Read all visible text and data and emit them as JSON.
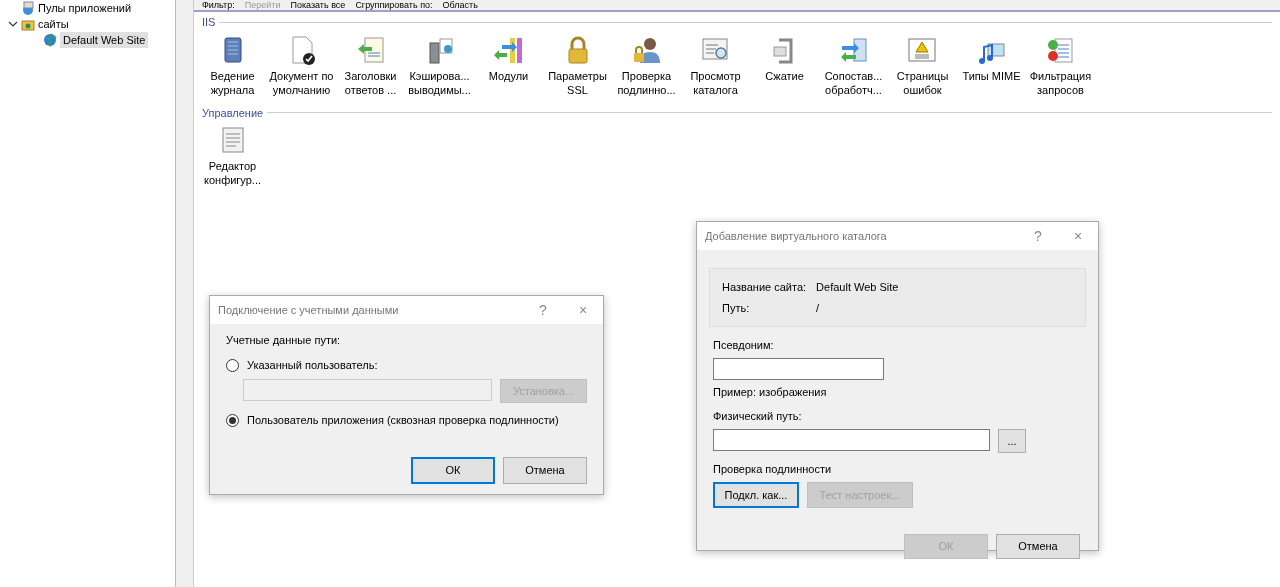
{
  "toolbar": {
    "items": [
      {
        "label": "Фильтр:",
        "kind": "label"
      },
      {
        "label": "Перейти",
        "kind": "button",
        "disabled": true
      },
      {
        "label": "Показать все",
        "kind": "button",
        "disabled": false
      },
      {
        "label": "Сгруппировать по:",
        "kind": "label"
      },
      {
        "label": "Область",
        "kind": "value"
      }
    ]
  },
  "tree": [
    {
      "label": "Пулы приложений",
      "selected": false
    },
    {
      "label": "сайты",
      "expanded": true,
      "selected": false,
      "children": [
        {
          "label": "Default Web Site",
          "selected": true
        }
      ]
    }
  ],
  "sections": [
    {
      "title": "IIS",
      "features": [
        {
          "label": "Ведение журнала"
        },
        {
          "label": "Документ по умолчанию"
        },
        {
          "label": "Заголовки ответов ..."
        },
        {
          "label": "Кэширова... выводимы..."
        },
        {
          "label": "Модули"
        },
        {
          "label": "Параметры SSL"
        },
        {
          "label": "Проверка подлинно..."
        },
        {
          "label": "Просмотр каталога"
        },
        {
          "label": "Сжатие"
        },
        {
          "label": "Сопостав... обработч..."
        },
        {
          "label": "Страницы ошибок"
        },
        {
          "label": "Типы MIME"
        },
        {
          "label": "Фильтрация запросов"
        }
      ]
    },
    {
      "title": "Управление",
      "features": [
        {
          "label": "Редактор конфигур..."
        }
      ]
    }
  ],
  "credentials_dialog": {
    "title": "Подключение с учетными данными",
    "help": "?",
    "close": "×",
    "group_label": "Учетные данные пути:",
    "options": [
      {
        "label": "Указанный пользователь:",
        "selected": false
      },
      {
        "label": "Пользователь приложения (сквозная проверка подлинности)",
        "selected": true
      }
    ],
    "user_field": {
      "disabled": true
    },
    "set_button": {
      "label": "Установка...",
      "disabled": true
    },
    "buttons": [
      {
        "label": "ОК",
        "disabled": false,
        "focused": true
      },
      {
        "label": "Отмена",
        "disabled": false,
        "focused": false
      }
    ]
  },
  "vdir_dialog": {
    "title": "Добавление виртуального каталога",
    "help": "?",
    "close": "×",
    "info": [
      {
        "label": "Название сайта:",
        "value": "Default Web Site"
      },
      {
        "label": "Путь:",
        "value": "/"
      }
    ],
    "alias_label": "Псевдоним:",
    "example": "Пример: изображения",
    "path_label": "Физический путь:",
    "browse": "...",
    "auth_label": "Проверка подлинности",
    "auth_buttons": [
      {
        "label": "Подкл. как...",
        "disabled": false,
        "focused": true
      },
      {
        "label": "Тест настроек...",
        "disabled": true,
        "focused": false
      }
    ],
    "buttons": [
      {
        "label": "ОК",
        "disabled": true,
        "focused": false
      },
      {
        "label": "Отмена",
        "disabled": false,
        "focused": false
      }
    ]
  }
}
